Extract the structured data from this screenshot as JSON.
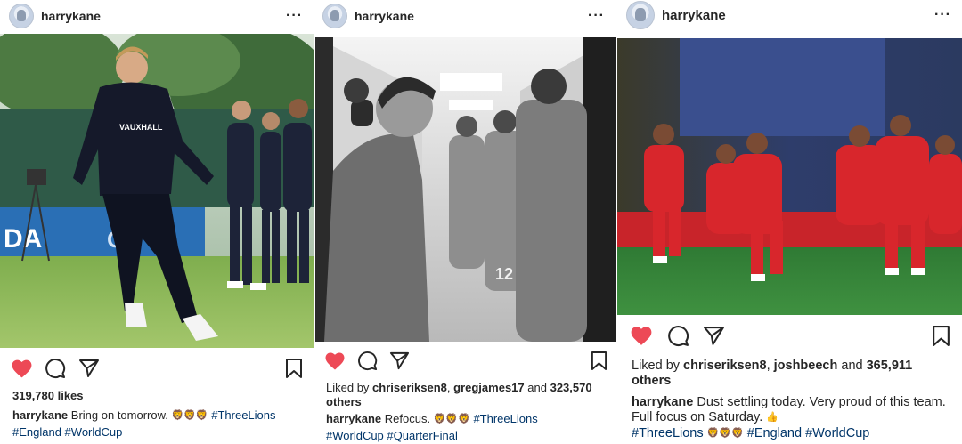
{
  "posts": [
    {
      "username": "harrykane",
      "more": "···",
      "likes": "319,780 likes",
      "caption_user": "harrykane",
      "caption_text": "Bring on tomorrow.",
      "caption_emojis": "🦁🦁🦁",
      "tags_line1": "#ThreeLions",
      "tags_line2": "#England #WorldCup",
      "photo_alt": "Player in navy training kit smiling on pitch",
      "shirt_text": "VAUXHALL"
    },
    {
      "username": "harrykane",
      "more": "···",
      "liked_by_prefix": "Liked by",
      "liked_by_user1": "chriseriksen8",
      "liked_by_user2": "gregjames17",
      "liked_by_and": "and",
      "liked_by_count": "323,570",
      "liked_by_others": "others",
      "caption_user": "harrykane",
      "caption_text": "Refocus.",
      "caption_emojis": "🦁🦁🦁",
      "tags_line1": "#ThreeLions",
      "tags_line2": "#WorldCup #QuarterFinal",
      "photo_alt": "Black and white tunnel photo of players"
    },
    {
      "username": "harrykane",
      "more": "···",
      "liked_by_prefix": "Liked by",
      "liked_by_user1": "chriseriksen8",
      "liked_by_user2": "joshbeech",
      "liked_by_and": "and",
      "liked_by_count": "365,911",
      "liked_by_others": "others",
      "caption_user": "harrykane",
      "caption_text": "Dust settling today. Very proud of this team. Full focus on Saturday.",
      "caption_emoji_hand": "👍",
      "tags_a": "#ThreeLions",
      "caption_emojis": "🦁🦁🦁",
      "tags_b": "#England #WorldCup",
      "photo_alt": "Team in red kits celebrating on pitch"
    }
  ],
  "colors": {
    "heart": "#ed4956",
    "link": "#003569",
    "text": "#262626"
  },
  "icons": [
    "heart-icon",
    "comment-icon",
    "share-icon",
    "bookmark-icon",
    "more-icon",
    "avatar"
  ]
}
